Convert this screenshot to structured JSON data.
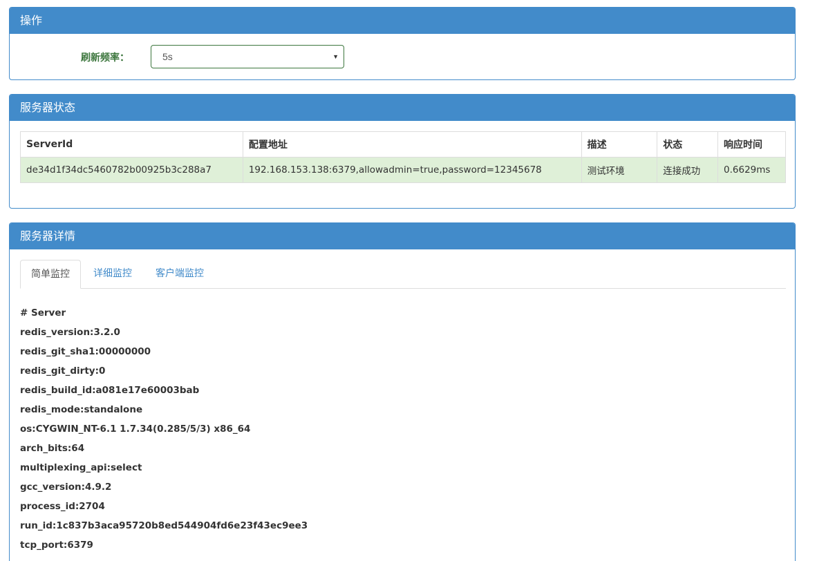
{
  "operations": {
    "title": "操作",
    "refresh_label": "刷新频率：",
    "refresh_value": "5s"
  },
  "server_status": {
    "title": "服务器状态",
    "columns": [
      "ServerId",
      "配置地址",
      "描述",
      "状态",
      "响应时间"
    ],
    "rows": [
      [
        "de34d1f34dc5460782b00925b3c288a7",
        "192.168.153.138:6379,allowadmin=true,password=12345678",
        "测试环境",
        "连接成功",
        "0.6629ms"
      ]
    ]
  },
  "server_detail": {
    "title": "服务器详情",
    "tabs": [
      "简单监控",
      "详细监控",
      "客户端监控"
    ],
    "active_tab": "简单监控",
    "lines": [
      "# Server",
      "redis_version:3.2.0",
      "redis_git_sha1:00000000",
      "redis_git_dirty:0",
      "redis_build_id:a081e17e60003bab",
      "redis_mode:standalone",
      "os:CYGWIN_NT-6.1 1.7.34(0.285/5/3) x86_64",
      "arch_bits:64",
      "multiplexing_api:select",
      "gcc_version:4.9.2",
      "process_id:2704",
      "run_id:1c837b3aca95720b8ed544904fd6e23f43ec9ee3",
      "tcp_port:6379"
    ]
  },
  "colors": {
    "primary": "#428bca",
    "success_text": "#3c763d",
    "success_bg": "#dff0d8",
    "border": "#dddddd"
  }
}
